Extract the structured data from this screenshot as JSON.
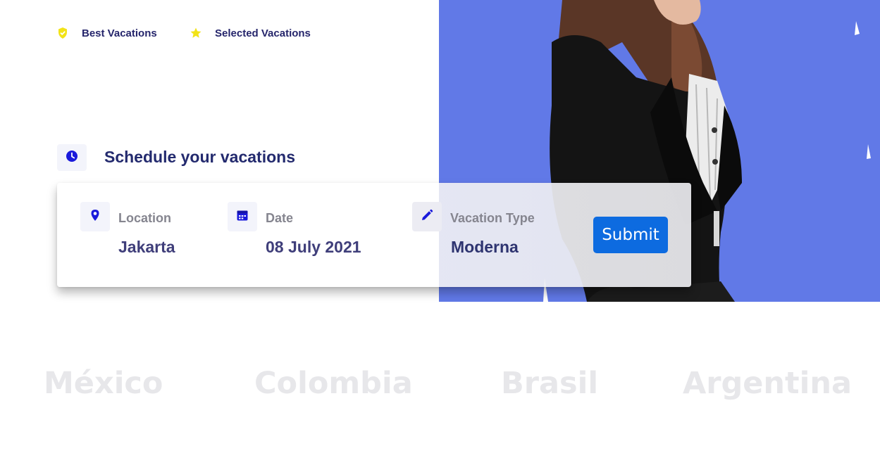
{
  "badges": [
    {
      "label": "Best Vacations",
      "icon": "shield-check-icon",
      "color": "#f2e318"
    },
    {
      "label": "Selected Vacations",
      "icon": "star-icon",
      "color": "#f2e318"
    }
  ],
  "schedule": {
    "title": "Schedule your vacations",
    "icon": "clock-icon"
  },
  "form": {
    "location": {
      "label": "Location",
      "value": "Jakarta",
      "icon": "location-pin-icon"
    },
    "date": {
      "label": "Date",
      "value": "08 July 2021",
      "icon": "calendar-icon"
    },
    "vacation_type": {
      "label": "Vacation Type",
      "value": "Moderna",
      "icon": "pencil-icon"
    },
    "submit_label": "Submit"
  },
  "countries": [
    "México",
    "Colombia",
    "Brasil",
    "Argentina"
  ],
  "colors": {
    "accent": "#0d6be0",
    "hero_background": "#6179e7",
    "heading": "#232a6e",
    "icon_blue": "#1a1adb"
  }
}
